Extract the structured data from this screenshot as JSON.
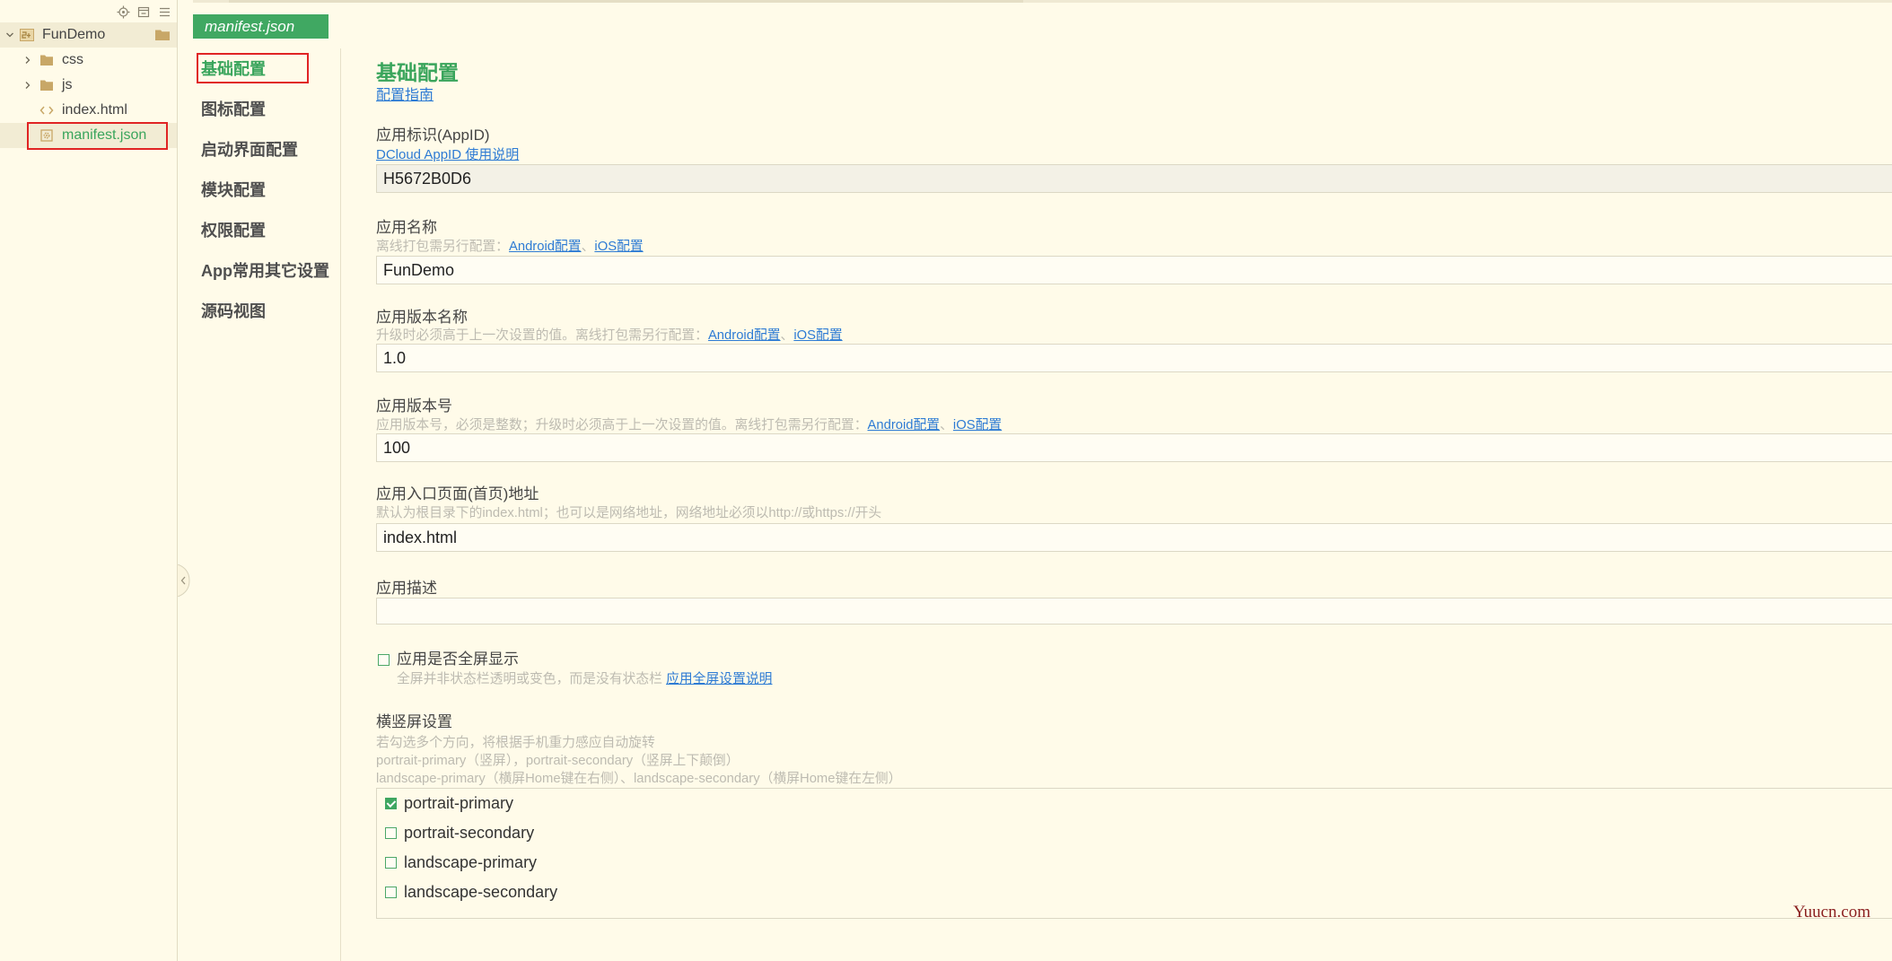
{
  "theme": {
    "background": "#fffbe9",
    "accent_green": "#3aa55c",
    "link_blue": "#2d7bd4",
    "highlight_red": "#e02424",
    "hint_gray": "#bdbbb1"
  },
  "sidebar": {
    "toolbar_icons": [
      "locate-icon",
      "collapse-all-icon",
      "menu-icon"
    ],
    "tree": {
      "project": {
        "label": "FunDemo",
        "icon": "project-icon",
        "expanded": true
      },
      "items": [
        {
          "label": "css",
          "icon": "folder-icon",
          "type": "folder",
          "expanded": false,
          "selected": false
        },
        {
          "label": "js",
          "icon": "folder-icon",
          "type": "folder",
          "expanded": false,
          "selected": false
        },
        {
          "label": "index.html",
          "icon": "html-file-icon",
          "type": "file",
          "selected": false
        },
        {
          "label": "manifest.json",
          "icon": "manifest-file-icon",
          "type": "file",
          "selected": true
        }
      ]
    }
  },
  "editor": {
    "active_tab": "manifest.json"
  },
  "nav": {
    "items": [
      {
        "label": "基础配置",
        "active": true
      },
      {
        "label": "图标配置",
        "active": false
      },
      {
        "label": "启动界面配置",
        "active": false
      },
      {
        "label": "模块配置",
        "active": false
      },
      {
        "label": "权限配置",
        "active": false
      },
      {
        "label": "App常用其它设置",
        "active": false
      },
      {
        "label": "源码视图",
        "active": false
      }
    ]
  },
  "main": {
    "title": "基础配置",
    "guide_link": "配置指南",
    "appid": {
      "label": "应用标识(AppID)",
      "help_link": "DCloud AppID 使用说明",
      "value": "H5672B0D6",
      "readonly": true
    },
    "app_name": {
      "label": "应用名称",
      "hint": "离线打包需另行配置：",
      "android_link": "Android配置",
      "separator": "、",
      "ios_link": "iOS配置",
      "value": "FunDemo"
    },
    "version_name": {
      "label": "应用版本名称",
      "hint": "升级时必须高于上一次设置的值。离线打包需另行配置：",
      "android_link": "Android配置",
      "separator": "、",
      "ios_link": "iOS配置",
      "value": "1.0"
    },
    "version_code": {
      "label": "应用版本号",
      "hint": "应用版本号，必须是整数；升级时必须高于上一次设置的值。离线打包需另行配置：",
      "android_link": "Android配置",
      "separator": "、",
      "ios_link": "iOS配置",
      "value": "100"
    },
    "launch_path": {
      "label": "应用入口页面(首页)地址",
      "hint": "默认为根目录下的index.html；也可以是网络地址，网络地址必须以http://或https://开头",
      "value": "index.html"
    },
    "description": {
      "label": "应用描述",
      "value": ""
    },
    "fullscreen": {
      "label": "应用是否全屏显示",
      "checked": false,
      "hint": "全屏并非状态栏透明或变色，而是没有状态栏",
      "help_link": "应用全屏设置说明"
    },
    "orientation": {
      "label": "横竖屏设置",
      "hints": [
        "若勾选多个方向，将根据手机重力感应自动旋转",
        "portrait-primary（竖屏），portrait-secondary（竖屏上下颠倒）",
        "landscape-primary（横屏Home键在右侧）、landscape-secondary（横屏Home键在左侧）"
      ],
      "options": [
        {
          "label": "portrait-primary",
          "checked": true
        },
        {
          "label": "portrait-secondary",
          "checked": false
        },
        {
          "label": "landscape-primary",
          "checked": false
        },
        {
          "label": "landscape-secondary",
          "checked": false
        }
      ]
    }
  },
  "watermark": "Yuucn.com"
}
